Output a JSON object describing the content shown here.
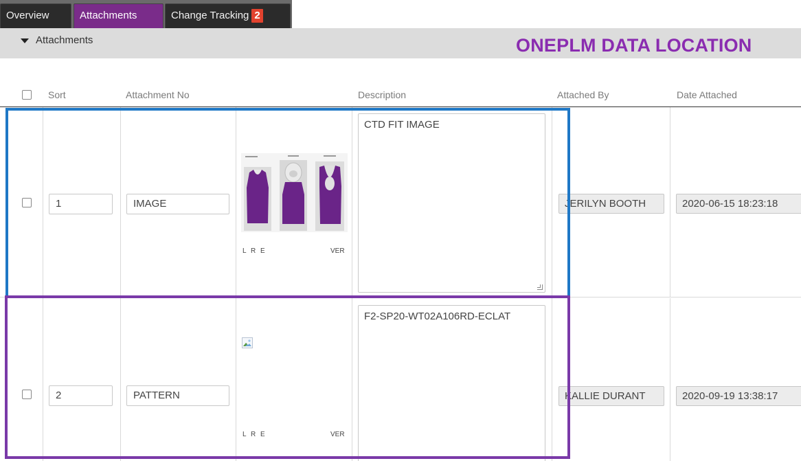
{
  "tabs": [
    {
      "label": "Overview"
    },
    {
      "label": "Attachments"
    },
    {
      "label": "Change Tracking",
      "badge": "2"
    }
  ],
  "section": {
    "title": "Attachments",
    "annotation": "ONEPLM DATA LOCATION"
  },
  "columns": {
    "sort": "Sort",
    "attachment_no": "Attachment No",
    "description": "Description",
    "attached_by": "Attached By",
    "date_attached": "Date Attached"
  },
  "rows": [
    {
      "sort": "1",
      "attachment_no": "IMAGE",
      "thumb_left": "L R E",
      "thumb_right": "VER",
      "description": "CTD FIT IMAGE",
      "attached_by": "JERILYN BOOTH",
      "date_attached": "2020-06-15 18:23:18"
    },
    {
      "sort": "2",
      "attachment_no": "PATTERN",
      "thumb_left": "L R E",
      "thumb_right": "VER",
      "description": "F2-SP20-WT02A106RD-ECLAT",
      "attached_by": "KALLIE DURANT",
      "date_attached": "2020-09-19 13:38:17"
    }
  ],
  "colors": {
    "active_tab": "#7a2c8a",
    "badge": "#e2422e",
    "annotation_text": "#8a2cb0",
    "highlight_blue": "#1f78c6",
    "highlight_purple": "#7a3aa8",
    "garment": "#6a2488"
  }
}
